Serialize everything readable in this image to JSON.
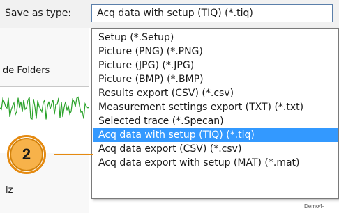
{
  "save_as_type": {
    "label": "Save as type:",
    "value": "Acq data with setup (TIQ) (*.tiq)"
  },
  "left_panel": {
    "hide_folders_label": "de Folders",
    "hz_label": "lz"
  },
  "file_type_options": [
    "Setup (*.Setup)",
    "Picture (PNG) (*.PNG)",
    "Picture (JPG) (*.JPG)",
    "Picture (BMP) (*.BMP)",
    "Results export (CSV) (*.csv)",
    "Measurement settings export (TXT) (*.txt)",
    "Selected trace (*.Specan)",
    "Acq data with setup (TIQ) (*.tiq)",
    "Acq data export (CSV) (*.csv)",
    "Acq data export with setup (MAT) (*.mat)"
  ],
  "selected_option_index": 7,
  "callout": {
    "number": "2"
  },
  "figure_id": "Demo4-",
  "colors": {
    "selection": "#3399ff",
    "callout_fill": "#f7b24a",
    "callout_stroke": "#e58a10",
    "trace": "#2aa22a"
  }
}
